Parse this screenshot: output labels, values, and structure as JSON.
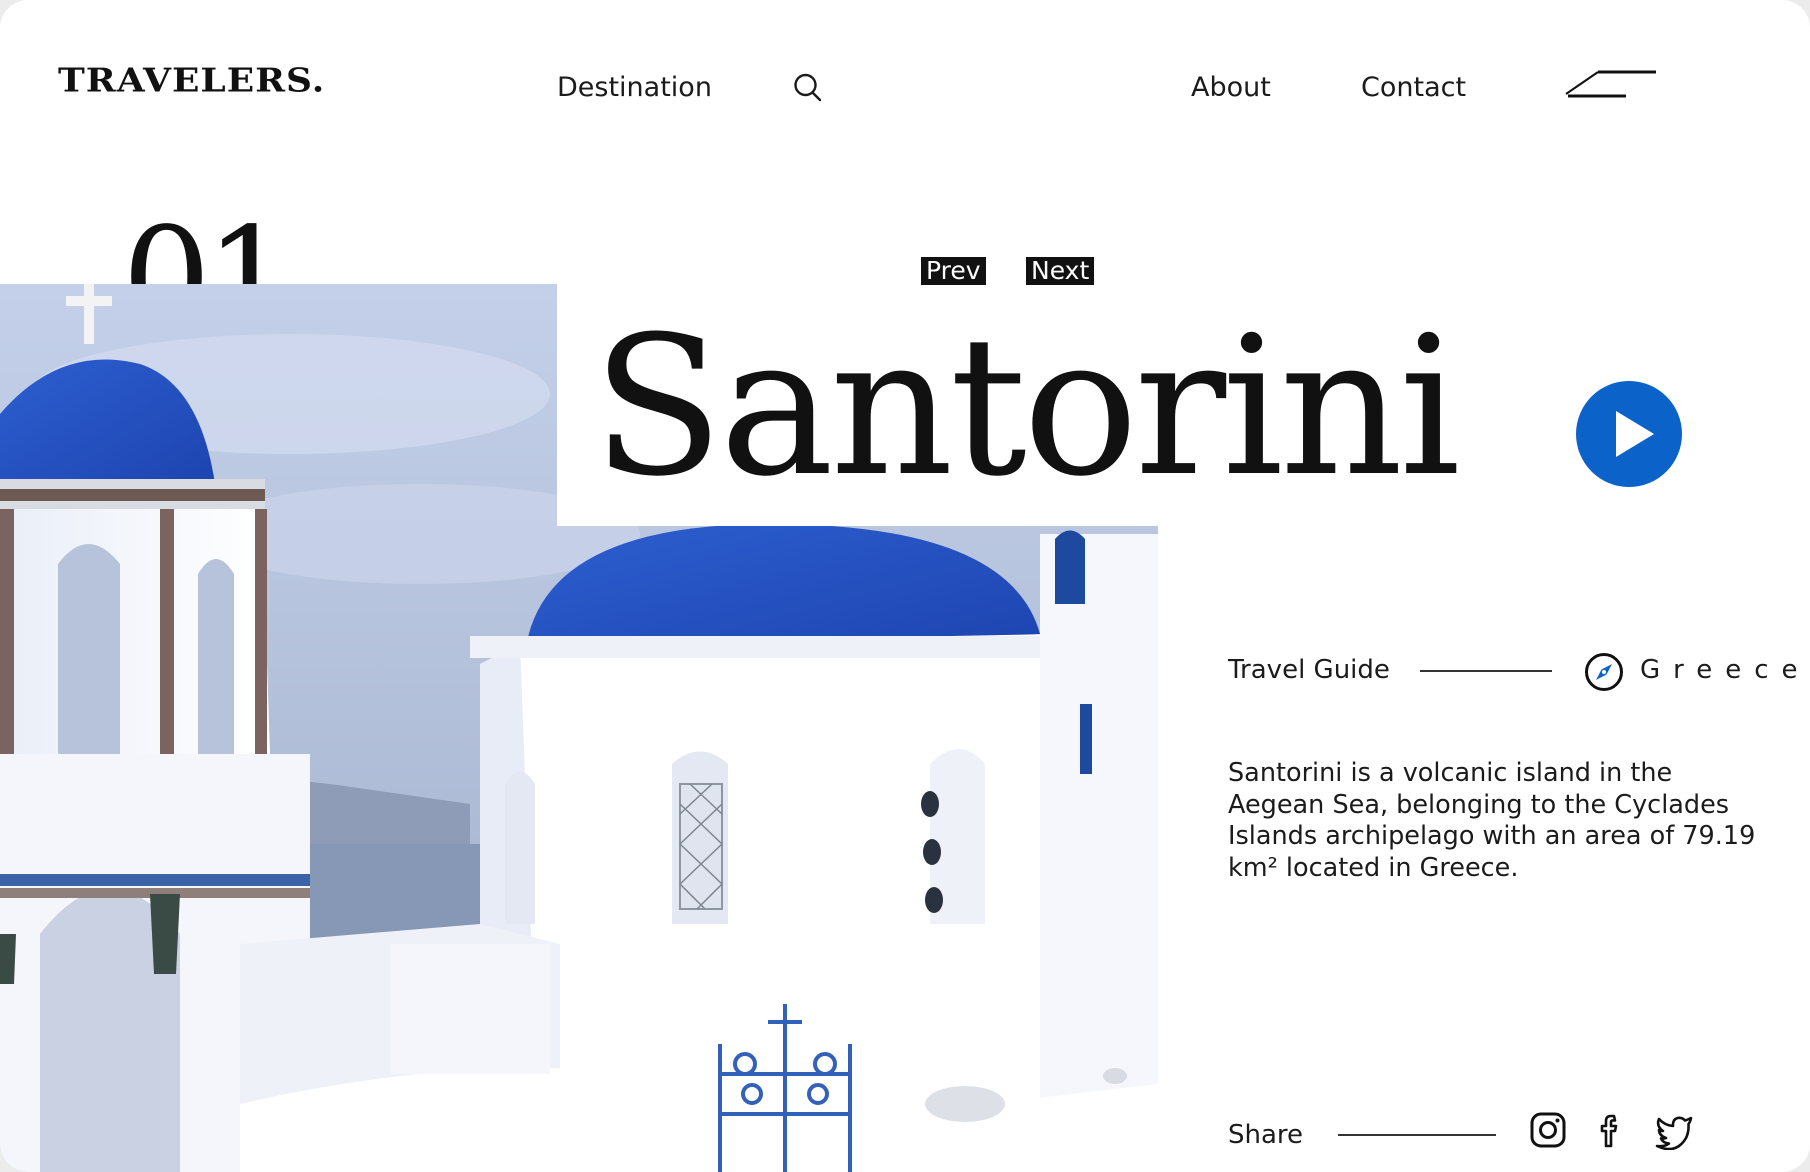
{
  "brand": {
    "logo": "TRAVELERS."
  },
  "nav": {
    "destination": "Destination",
    "about": "About",
    "contact": "Contact",
    "search_icon": "search-icon",
    "menu_icon": "menu-icon"
  },
  "hero": {
    "index": "01",
    "title": "Santorini",
    "prev": "Prev",
    "next": "Next",
    "play_icon": "play-icon"
  },
  "info": {
    "guide_label": "Travel Guide",
    "country": "Greece",
    "description": "Santorini is a volcanic island in the Aegean Sea, belonging to the Cyclades Islands archipelago with an area of 79.19 km² located in Greece."
  },
  "share": {
    "label": "Share",
    "icons": [
      "instagram-icon",
      "facebook-icon",
      "twitter-icon"
    ]
  },
  "colors": {
    "accent": "#0b63c9",
    "text": "#111111",
    "background": "#ffffff"
  }
}
